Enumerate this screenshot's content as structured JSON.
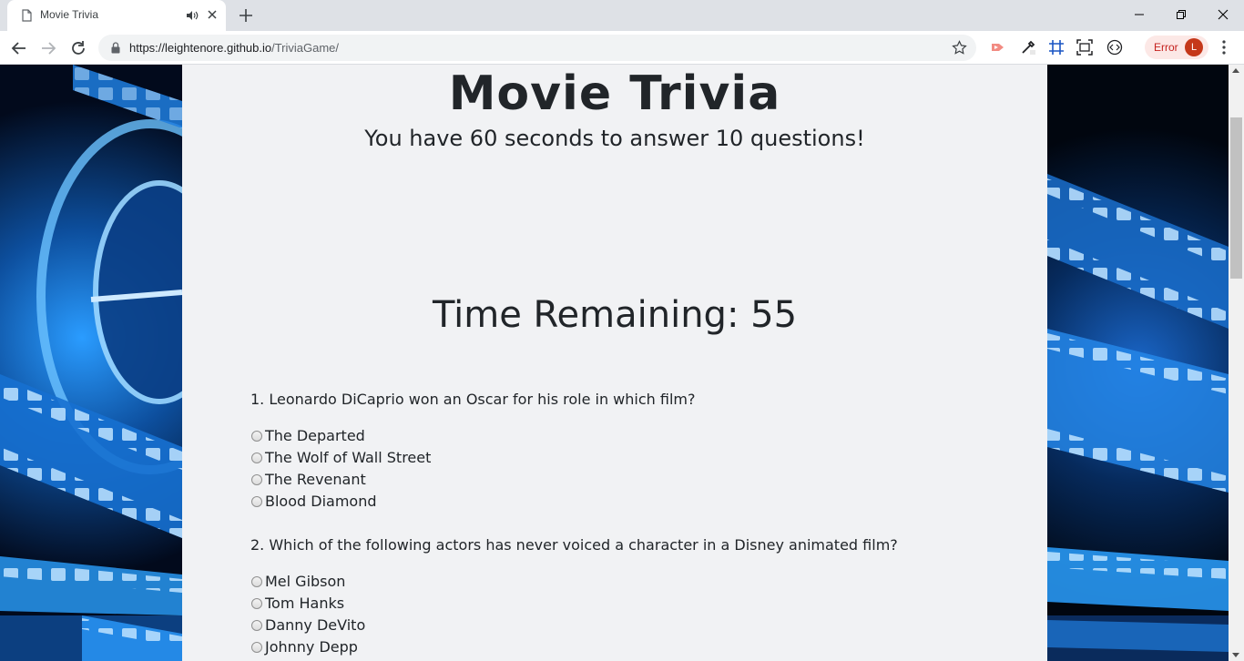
{
  "browser": {
    "tab_title": "Movie Trivia",
    "url_host": "https://leightenore.github.io",
    "url_path": "/TriviaGame/",
    "error_label": "Error",
    "avatar_letter": "L"
  },
  "page": {
    "title": "Movie Trivia",
    "subtitle": "You have 60 seconds to answer 10 questions!",
    "timer_label": "Time Remaining: ",
    "timer_value": "55",
    "questions": [
      {
        "text": "1. Leonardo DiCaprio won an Oscar for his role in which film?",
        "options": [
          "The Departed",
          "The Wolf of Wall Street",
          "The Revenant",
          "Blood Diamond"
        ]
      },
      {
        "text": "2. Which of the following actors has never voiced a character in a Disney animated film?",
        "options": [
          "Mel Gibson",
          "Tom Hanks",
          "Danny DeVito",
          "Johnny Depp"
        ]
      }
    ]
  },
  "colors": {
    "panel_bg": "#f1f2f4",
    "text": "#212529",
    "film_blue": "#1e8cf0"
  }
}
